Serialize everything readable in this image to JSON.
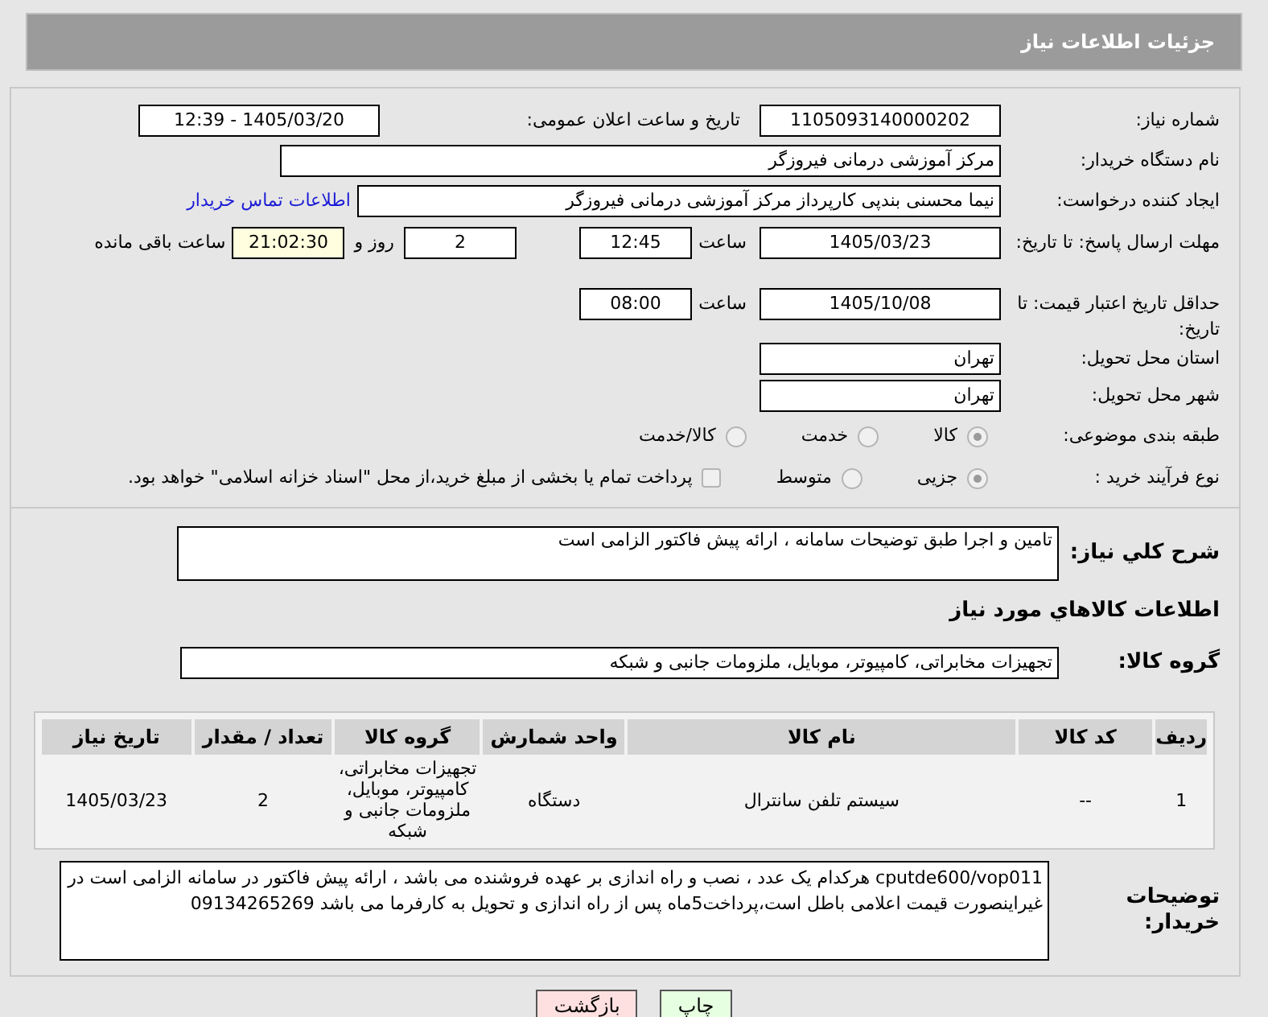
{
  "header": {
    "title": "جزئیات اطلاعات نیاز"
  },
  "need_number": {
    "label": "شماره نیاز:",
    "value": "1105093140000202"
  },
  "announce_datetime": {
    "label": "تاریخ و ساعت اعلان عمومی:",
    "value": "1405/03/20 - 12:39"
  },
  "buyer_org": {
    "label": "نام دستگاه خریدار:",
    "value": "مرکز آموزشی درمانی فیروزگر"
  },
  "requester": {
    "label": "ایجاد کننده درخواست:",
    "value": "نیما محسنی بندپی کارپرداز مرکز آموزشی درمانی فیروزگر",
    "link": "اطلاعات تماس خریدار"
  },
  "response_deadline": {
    "label": "مهلت ارسال پاسخ: تا تاریخ:",
    "date": "1405/03/23",
    "time_label": "ساعت",
    "time": "12:45",
    "days": "2",
    "days_label": "روز و",
    "remaining": "21:02:30",
    "remaining_label": "ساعت باقی مانده"
  },
  "price_validity": {
    "label": "حداقل تاریخ اعتبار قیمت: تا تاریخ:",
    "date": "1405/10/08",
    "time_label": "ساعت",
    "time": "08:00"
  },
  "province": {
    "label": "استان محل تحویل:",
    "value": "تهران"
  },
  "city": {
    "label": "شهر محل تحویل:",
    "value": "تهران"
  },
  "category": {
    "label": "طبقه بندی موضوعی:",
    "options": [
      {
        "label": "کالا",
        "selected": true
      },
      {
        "label": "خدمت",
        "selected": false
      },
      {
        "label": "کالا/خدمت",
        "selected": false
      }
    ]
  },
  "purchase_process": {
    "label": "نوع فرآیند خرید :",
    "options": [
      {
        "label": "جزیی",
        "selected": true
      },
      {
        "label": "متوسط",
        "selected": false
      }
    ],
    "checkbox": {
      "label": "پرداخت تمام یا بخشی از مبلغ خرید،از محل \"اسناد خزانه اسلامی\" خواهد بود.",
      "checked": false
    }
  },
  "description": {
    "label": "شرح کلي نياز:",
    "value": "تامین و اجرا طبق توضیحات سامانه ، ارائه پیش فاکتور الزامی است"
  },
  "goods_heading": "اطلاعات کالاهاي مورد نياز",
  "goods_group": {
    "label": "گروه کالا:",
    "value": "تجهیزات مخابراتی، کامپیوتر، موبایل، ملزومات جانبی و شبکه"
  },
  "table": {
    "columns": [
      "ردیف",
      "کد کالا",
      "نام کالا",
      "واحد شمارش",
      "گروه کالا",
      "تعداد / مقدار",
      "تاریخ نیاز"
    ],
    "rows": [
      [
        "1",
        "--",
        "سیستم تلفن سانترال",
        "دستگاه",
        "تجهیزات مخابراتی، کامپیوتر، موبایل، ملزومات جانبی و شبکه",
        "2",
        "1405/03/23"
      ]
    ]
  },
  "buyer_notes": {
    "label": "توضیحات خریدار:",
    "value": "cputde600/vop011 هرکدام یک عدد ، نصب و راه اندازی بر عهده فروشنده می باشد ، ارائه پیش فاکتور در سامانه الزامی است در غیراینصورت قیمت اعلامی باطل است،پرداخت5ماه پس از راه اندازی و تحویل به کارفرما می باشد 09134265269"
  },
  "buttons": [
    {
      "label": "چاپ",
      "kind": "print"
    },
    {
      "label": "بازگشت",
      "kind": "back"
    }
  ]
}
